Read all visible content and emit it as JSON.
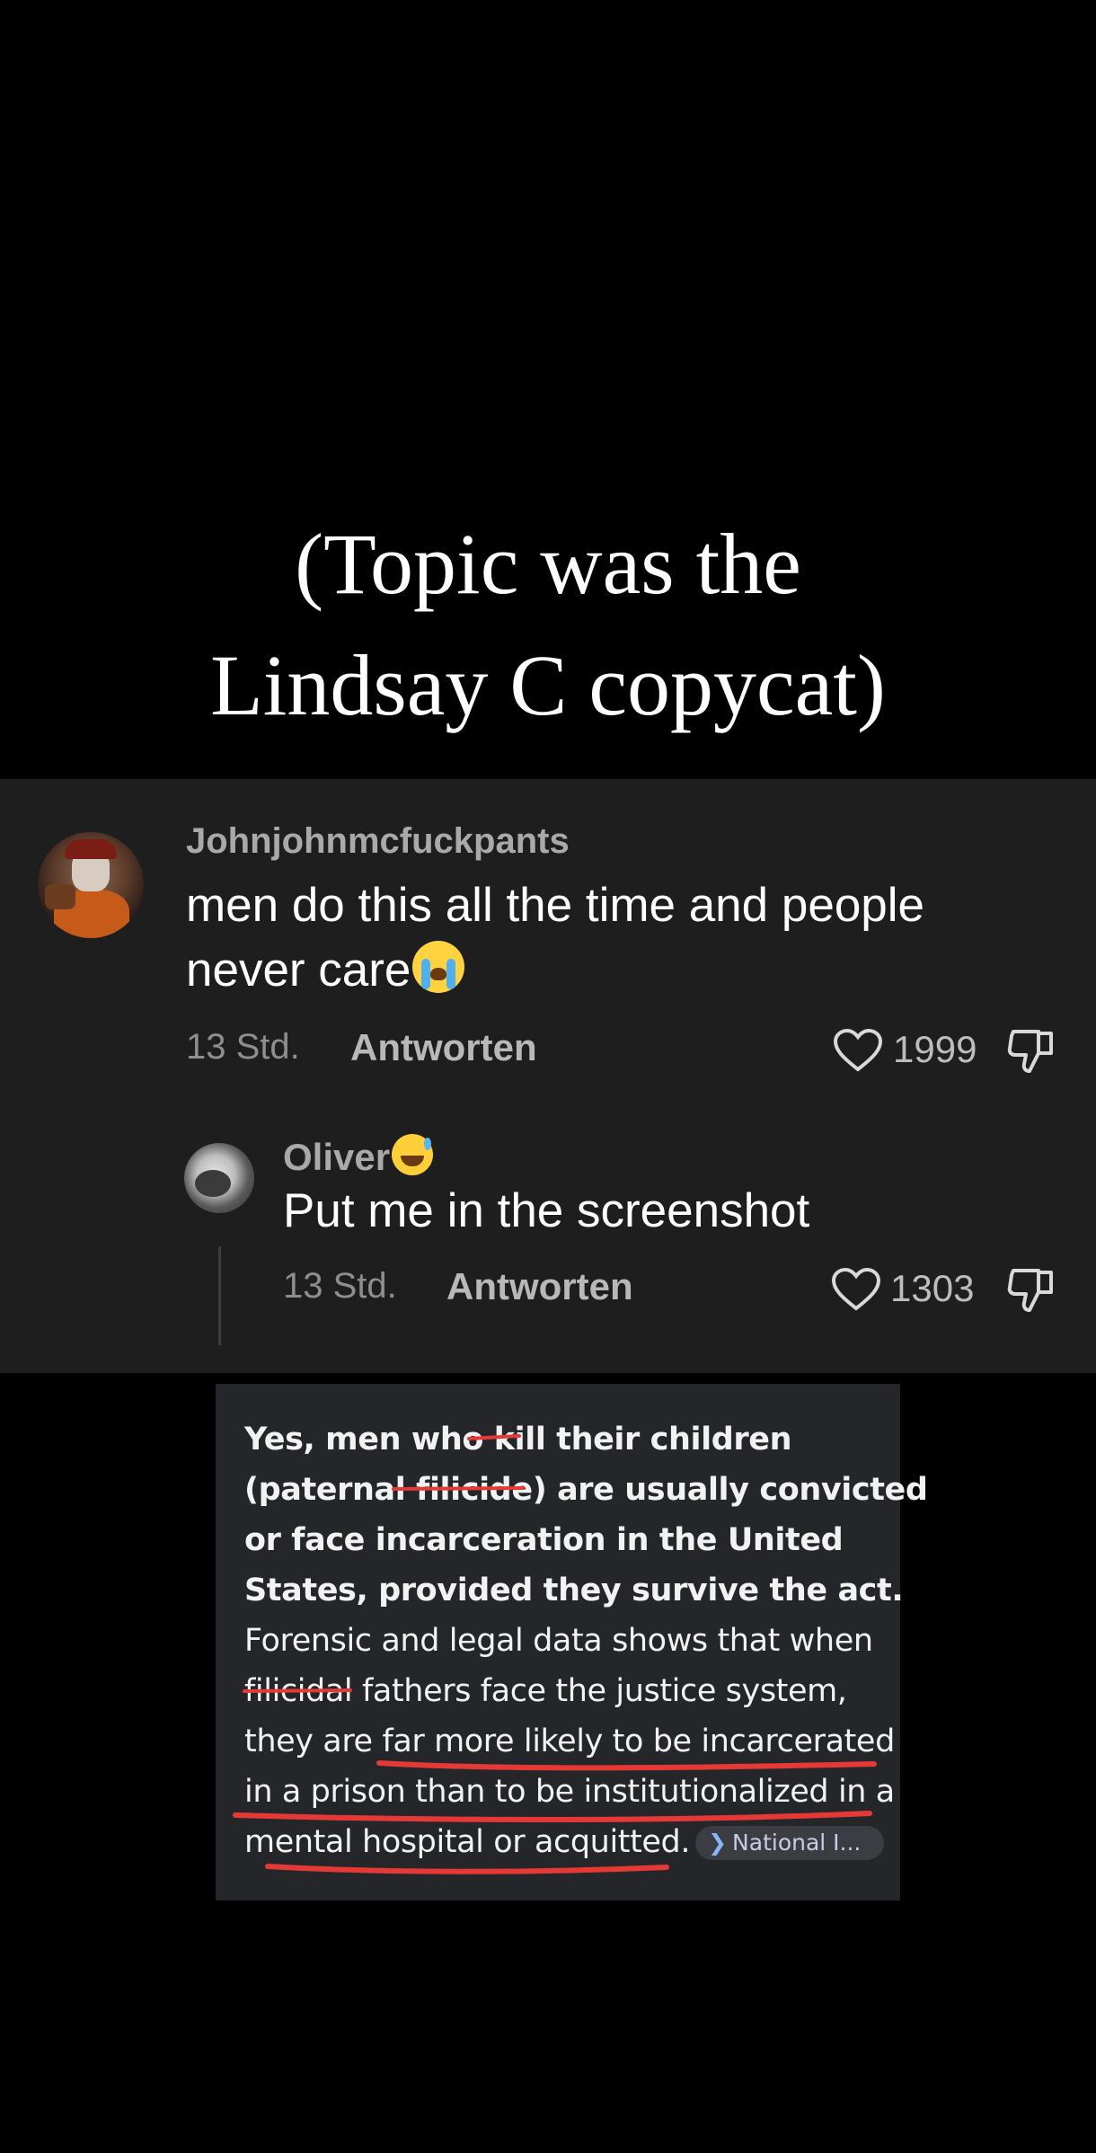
{
  "caption": {
    "line1": "(Topic was the",
    "line2": "Lindsay C copycat)"
  },
  "comment1": {
    "username": "Johnjohnmcfuckpants",
    "text_line1": "men do this all the time and people",
    "text_line2": "never care",
    "emoji": "loudly-crying-face-emoji",
    "time": "13 Std.",
    "reply_label": "Antworten",
    "likes": "1999"
  },
  "comment2": {
    "username": "Oliver",
    "emoji": "grinning-sweat-face-emoji",
    "text": "Put me in the screenshot",
    "time": "13 Std.",
    "reply_label": "Antworten",
    "likes": "1303"
  },
  "ai_answer": {
    "l1_a": "Yes, men who ",
    "l1_b": "kill",
    "l1_c": " their children",
    "l2_a": "(paternal ",
    "l2_b": "filicide",
    "l2_c": ") are usually convicted",
    "l3": "or face incarceration in the United",
    "l4": "States, provided they survive the act.",
    "l5": "Forensic and legal data shows that when",
    "l6_a": "filicidal",
    "l6_b": " fathers face the justice system,",
    "l7": "they are far more likely to be incarcerated",
    "l8": "in a prison than to be institutionalized in a",
    "l9": "mental hospital or acquitted.",
    "source_chip": "National I...",
    "annotation_color": "#e53935"
  },
  "colors": {
    "background": "#000000",
    "comment_panel": "#1e1e1e",
    "ai_panel": "#25262a"
  }
}
